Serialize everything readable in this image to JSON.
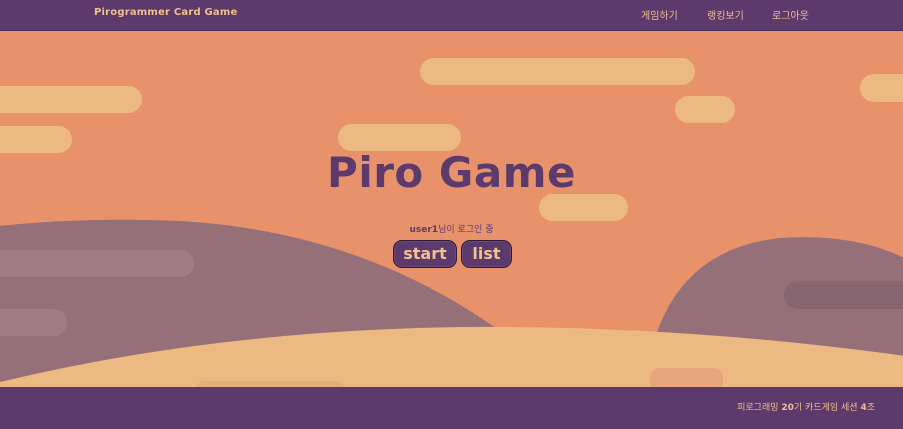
{
  "header": {
    "brand": "Pirogrammer Card Game",
    "nav": [
      {
        "label": "게임하기"
      },
      {
        "label": "랭킹보기"
      },
      {
        "label": "로그아웃"
      }
    ]
  },
  "hero": {
    "title": "Piro Game",
    "username": "user1",
    "login_suffix": "님이 로그인 중",
    "start_label": "start",
    "list_label": "list"
  },
  "footer": {
    "prefix": "피로그래밍 ",
    "generation": "20",
    "middle": "기 카드게임 세션 ",
    "team": "4",
    "suffix": "조"
  },
  "colors": {
    "header_bg": "#5c3a6b",
    "accent_text": "#f0c090",
    "sky": "#e8926c",
    "cloud": "#edb983",
    "hill": "#957078",
    "sand": "#edb983"
  }
}
